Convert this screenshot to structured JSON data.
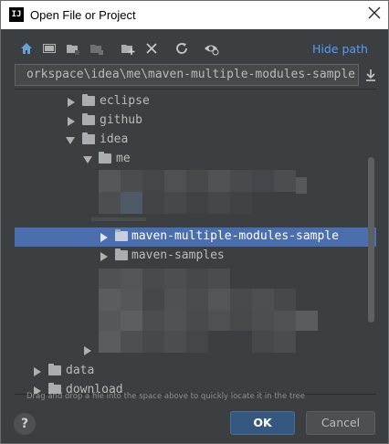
{
  "window": {
    "title": "Open File or Project",
    "app_icon_text": "IJ"
  },
  "toolbar": {
    "icons": [
      "home-icon",
      "desktop-icon",
      "project-folder-icon",
      "module-folder-icon",
      "new-folder-icon",
      "delete-icon",
      "refresh-icon",
      "show-hidden-icon"
    ],
    "hide_path_label": "Hide path"
  },
  "path": {
    "value": "orkspace\\idea\\me\\maven-multiple-modules-sample"
  },
  "tree": {
    "items": [
      {
        "label": "eclipse",
        "expanded": false
      },
      {
        "label": "github",
        "expanded": false
      },
      {
        "label": "idea",
        "expanded": true
      },
      {
        "label": "me",
        "expanded": true
      },
      {
        "label": "maven-multiple-modules-sample",
        "expanded": false,
        "selected": true
      },
      {
        "label": "maven-samples",
        "expanded": false
      },
      {
        "label": "data",
        "expanded": false
      },
      {
        "label": "download",
        "expanded": false
      }
    ]
  },
  "hint": "Drag and drop a file into the space above to quickly locate it in the tree",
  "buttons": {
    "help": "?",
    "ok": "OK",
    "cancel": "Cancel"
  },
  "colors": {
    "background": "#3c3f41",
    "selection": "#4b6eaf",
    "link": "#589df6",
    "default_button": "#365880"
  }
}
